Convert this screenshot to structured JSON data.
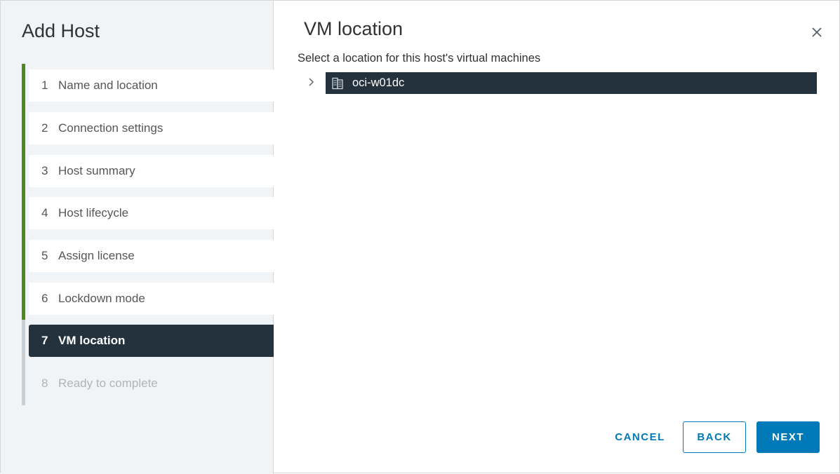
{
  "wizard": {
    "title": "Add Host",
    "steps": [
      {
        "num": "1",
        "label": "Name and location",
        "state": "done"
      },
      {
        "num": "2",
        "label": "Connection settings",
        "state": "done"
      },
      {
        "num": "3",
        "label": "Host summary",
        "state": "done"
      },
      {
        "num": "4",
        "label": "Host lifecycle",
        "state": "done"
      },
      {
        "num": "5",
        "label": "Assign license",
        "state": "done"
      },
      {
        "num": "6",
        "label": "Lockdown mode",
        "state": "done"
      },
      {
        "num": "7",
        "label": "VM location",
        "state": "active"
      },
      {
        "num": "8",
        "label": "Ready to complete",
        "state": "future"
      }
    ]
  },
  "page": {
    "title": "VM location",
    "subtitle": "Select a location for this host's virtual machines",
    "close_icon": "close-icon"
  },
  "tree": {
    "items": [
      {
        "label": "oci-w01dc",
        "icon": "datacenter-icon",
        "selected": true,
        "expandable": true
      }
    ]
  },
  "footer": {
    "cancel_label": "CANCEL",
    "back_label": "BACK",
    "next_label": "NEXT"
  },
  "colors": {
    "accent": "#0079b8",
    "selected_bg": "#23323d",
    "done_track": "#4a8b1c",
    "todo_track": "#c8d0d5"
  }
}
